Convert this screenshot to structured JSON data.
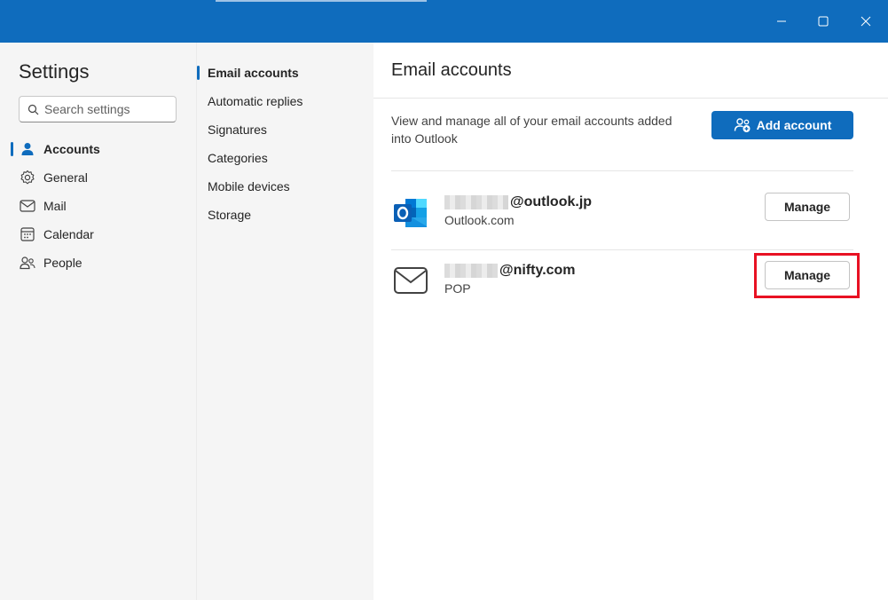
{
  "window": {
    "controls": {
      "minimize": "minimize-icon",
      "maximize": "maximize-icon",
      "close": "close-icon"
    }
  },
  "left_nav": {
    "title": "Settings",
    "search": {
      "placeholder": "Search settings",
      "value": ""
    },
    "items": [
      {
        "label": "Accounts",
        "icon": "person-icon",
        "selected": true
      },
      {
        "label": "General",
        "icon": "gear-icon",
        "selected": false
      },
      {
        "label": "Mail",
        "icon": "mail-icon",
        "selected": false
      },
      {
        "label": "Calendar",
        "icon": "calendar-icon",
        "selected": false
      },
      {
        "label": "People",
        "icon": "people-icon",
        "selected": false
      }
    ]
  },
  "sub_nav": {
    "items": [
      {
        "label": "Email accounts",
        "selected": true
      },
      {
        "label": "Automatic replies",
        "selected": false
      },
      {
        "label": "Signatures",
        "selected": false
      },
      {
        "label": "Categories",
        "selected": false
      },
      {
        "label": "Mobile devices",
        "selected": false
      },
      {
        "label": "Storage",
        "selected": false
      }
    ]
  },
  "content": {
    "title": "Email accounts",
    "description": "View and manage all of your email accounts added into Outlook",
    "add_account_label": "Add account",
    "accounts": [
      {
        "email_domain": "@outlook.jp",
        "type": "Outlook.com",
        "icon": "outlook-logo-icon",
        "manage_label": "Manage"
      },
      {
        "email_domain": "@nifty.com",
        "type": "POP",
        "icon": "envelope-icon",
        "manage_label": "Manage"
      }
    ]
  },
  "colors": {
    "brand": "#0f6cbd",
    "highlight": "#e81123",
    "nav_bg": "#f5f5f5"
  }
}
